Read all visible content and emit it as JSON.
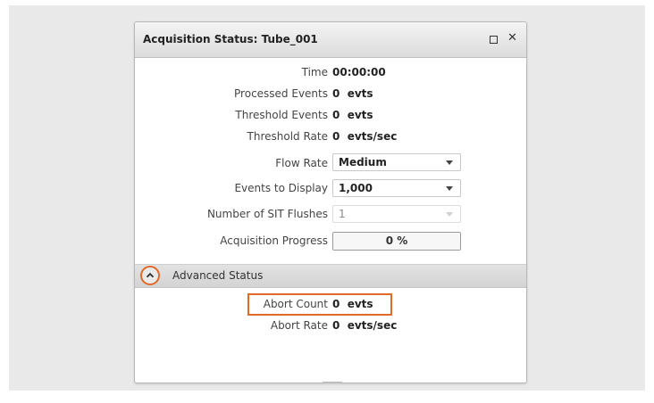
{
  "panel": {
    "title": "Acquisition Status: Tube_001",
    "maximize_icon": "maximize-icon",
    "close_icon": "close-icon",
    "close_glyph": "✕"
  },
  "status": {
    "time_label": "Time",
    "time_value": "00:00:00",
    "processed_label": "Processed Events",
    "processed_value": "0  evts",
    "threshold_events_label": "Threshold Events",
    "threshold_events_value": "0  evts",
    "threshold_rate_label": "Threshold Rate",
    "threshold_rate_value": "0  evts/sec",
    "flow_rate_label": "Flow Rate",
    "flow_rate_value": "Medium",
    "events_display_label": "Events to Display",
    "events_display_value": "1,000",
    "sit_flushes_label": "Number of SIT Flushes",
    "sit_flushes_value": "1",
    "progress_label": "Acquisition Progress",
    "progress_text": "0 %",
    "progress_fraction": 0
  },
  "advanced": {
    "label": "Advanced Status",
    "expanded": true,
    "toggle_icon": "chevron-up-icon",
    "abort_count_label": "Abort Count",
    "abort_count_value": "0  evts",
    "abort_rate_label": "Abort Rate",
    "abort_rate_value": "0  evts/sec"
  },
  "colors": {
    "highlight": "#e06a2a",
    "titlebar": "#e4e4e4"
  }
}
